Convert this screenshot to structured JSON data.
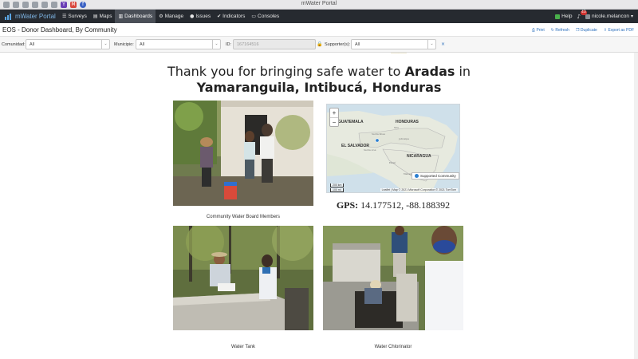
{
  "browser": {
    "window_title": "mWater Portal"
  },
  "navbar": {
    "brand": "mWater Portal",
    "items": [
      {
        "label": "Surveys",
        "icon": "list-icon"
      },
      {
        "label": "Maps",
        "icon": "map-icon"
      },
      {
        "label": "Dashboards",
        "icon": "bar-chart-icon",
        "active": true
      },
      {
        "label": "Manage",
        "icon": "gear-icon"
      },
      {
        "label": "Issues",
        "icon": "alert-icon"
      },
      {
        "label": "Indicators",
        "icon": "check-circle-icon"
      },
      {
        "label": "Consoles",
        "icon": "monitor-icon"
      }
    ],
    "help_label": "Help",
    "notification_count": "43",
    "user_name": "nicole.melancon"
  },
  "page": {
    "title": "EOS - Donor Dashboard, By Community",
    "actions": [
      {
        "label": "Print",
        "icon": "print-icon"
      },
      {
        "label": "Refresh",
        "icon": "refresh-icon"
      },
      {
        "label": "Duplicate",
        "icon": "duplicate-icon"
      },
      {
        "label": "Export as PDF",
        "icon": "export-icon"
      }
    ]
  },
  "filters": {
    "comunidad_label": "Comunidad:",
    "comunidad_value": "All",
    "municipio_label": "Municipio:",
    "municipio_value": "All",
    "id_label": "ID:",
    "id_value": "167164516",
    "supporters_label": "Supporter(s):",
    "supporters_value": "All"
  },
  "content": {
    "heading_prefix": "Thank you for bringing safe water to ",
    "community": "Aradas",
    "heading_in": " in",
    "location": "Yamaranguila, Intibucá, Honduras",
    "photos": [
      {
        "caption": "Community Water Board Members"
      },
      {
        "caption": "Water Tank"
      },
      {
        "caption": "Water Chlorinator"
      }
    ],
    "map": {
      "legend": "Supported Community",
      "labels": [
        "GUATEMALA",
        "HONDURAS",
        "EL SALVADOR",
        "NICARAGUA"
      ],
      "scale_km": "200 km",
      "scale_mi": "100 mi",
      "attribution": "Leaflet | Map © 2021 Microsoft Corporation © 2021 TomTom"
    },
    "gps_label": "GPS:",
    "gps_value": " 14.177512, -88.188392"
  }
}
